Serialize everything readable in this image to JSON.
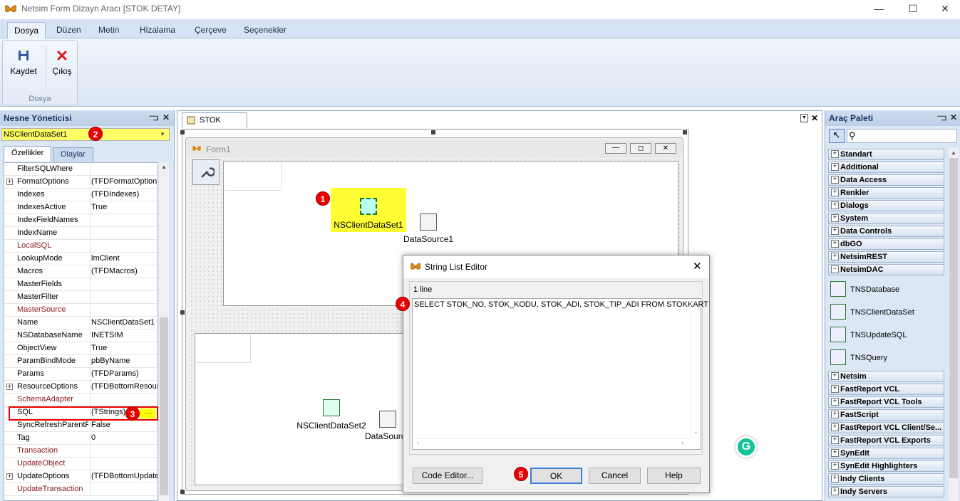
{
  "window": {
    "title": "Netsim Form Dizayn Aracı [STOK DETAY]"
  },
  "ribbon": {
    "tabs": [
      "Dosya",
      "Düzen",
      "Metin",
      "Hizalama",
      "Çerçeve",
      "Seçenekler"
    ],
    "active_tab": "Dosya",
    "save_label": "Kaydet",
    "exit_label": "Çıkış",
    "group_label": "Dosya"
  },
  "object_inspector": {
    "title": "Nesne Yöneticisi",
    "selected": "NSClientDataSet1",
    "tabs": [
      "Özellikler",
      "Olaylar"
    ],
    "props": [
      {
        "name": "FilterSQLWhere",
        "value": "",
        "exp": false,
        "red": false
      },
      {
        "name": "FormatOptions",
        "value": "(TFDFormatOption",
        "exp": true,
        "red": false
      },
      {
        "name": "Indexes",
        "value": "(TFDIndexes)",
        "exp": false,
        "red": false
      },
      {
        "name": "IndexesActive",
        "value": "True",
        "exp": false,
        "red": false
      },
      {
        "name": "IndexFieldNames",
        "value": "",
        "exp": false,
        "red": false
      },
      {
        "name": "IndexName",
        "value": "",
        "exp": false,
        "red": false
      },
      {
        "name": "LocalSQL",
        "value": "",
        "exp": false,
        "red": true
      },
      {
        "name": "LookupMode",
        "value": "lmClient",
        "exp": false,
        "red": false
      },
      {
        "name": "Macros",
        "value": "(TFDMacros)",
        "exp": false,
        "red": false
      },
      {
        "name": "MasterFields",
        "value": "",
        "exp": false,
        "red": false
      },
      {
        "name": "MasterFilter",
        "value": "",
        "exp": false,
        "red": false
      },
      {
        "name": "MasterSource",
        "value": "",
        "exp": false,
        "red": true
      },
      {
        "name": "Name",
        "value": "NSClientDataSet1",
        "exp": false,
        "red": false
      },
      {
        "name": "NSDatabaseName",
        "value": "INETSIM",
        "exp": false,
        "red": false
      },
      {
        "name": "ObjectView",
        "value": "True",
        "exp": false,
        "red": false
      },
      {
        "name": "ParamBindMode",
        "value": "pbByName",
        "exp": false,
        "red": false
      },
      {
        "name": "Params",
        "value": "(TFDParams)",
        "exp": false,
        "red": false
      },
      {
        "name": "ResourceOptions",
        "value": "(TFDBottomResour",
        "exp": true,
        "red": false
      },
      {
        "name": "SchemaAdapter",
        "value": "",
        "exp": false,
        "red": true
      },
      {
        "name": "SQL",
        "value": "(TStrings)",
        "exp": false,
        "red": false
      },
      {
        "name": "SyncRefreshParentF",
        "value": "False",
        "exp": false,
        "red": false
      },
      {
        "name": "Tag",
        "value": "0",
        "exp": false,
        "red": false
      },
      {
        "name": "Transaction",
        "value": "",
        "exp": false,
        "red": true
      },
      {
        "name": "UpdateObject",
        "value": "",
        "exp": false,
        "red": true
      },
      {
        "name": "UpdateOptions",
        "value": "(TFDBottomUpdate",
        "exp": true,
        "red": false
      },
      {
        "name": "UpdateTransaction",
        "value": "",
        "exp": false,
        "red": true
      }
    ]
  },
  "designer": {
    "doc_tab": "STOK DETAY",
    "form_title": "Form1",
    "components": {
      "cds1": "NSClientDataSet1",
      "ds1": "DataSource1",
      "cds2": "NSClientDataSet2",
      "ds2": "DataSourc"
    }
  },
  "dialog": {
    "title": "String List Editor",
    "line_count": "1 line",
    "sql_text": "SELECT STOK_NO, STOK_KODU, STOK_ADI, STOK_TIP_ADI FROM STOKKART",
    "code_editor": "Code Editor...",
    "ok": "OK",
    "cancel": "Cancel",
    "help": "Help"
  },
  "badges": [
    "1",
    "2",
    "3",
    "4",
    "5"
  ],
  "palette": {
    "title": "Araç Paleti",
    "categories_top": [
      "Standart",
      "Additional",
      "Data Access",
      "Renkler",
      "Dialogs",
      "System",
      "Data Controls",
      "dbGO",
      "NetsimREST",
      "NetsimDAC"
    ],
    "items": [
      "TNSDatabase",
      "TNSClientDataSet",
      "TNSUpdateSQL",
      "TNSQuery"
    ],
    "categories_bottom": [
      "Netsim",
      "FastReport VCL",
      "FastReport VCL Tools",
      "FastScript",
      "FastReport VCL Client/Se...",
      "FastReport VCL Exports",
      "SynEdit",
      "SynEdit Highlighters",
      "Indy Clients",
      "Indy Servers"
    ]
  },
  "colors": {
    "highlight": "#ffff00",
    "badge": "#e00000",
    "ribbon": "#d6e3f4"
  }
}
